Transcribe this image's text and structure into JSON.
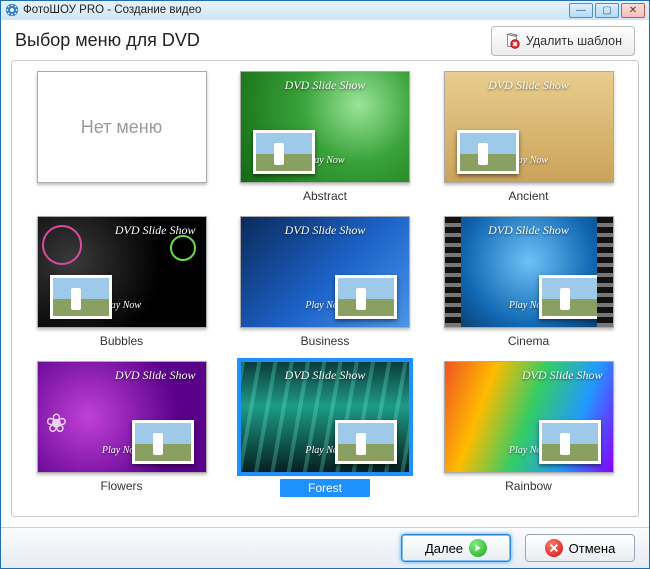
{
  "titlebar": {
    "title": "ФотоШОУ PRO - Создание видео"
  },
  "header": {
    "heading": "Выбор меню для DVD",
    "delete_template": "Удалить шаблон"
  },
  "template_strings": {
    "slide_title": "DVD Slide Show",
    "play_now": "Play Now"
  },
  "templates": [
    {
      "id": "none",
      "label": "Нет меню",
      "bg": "bg-none",
      "selected": false,
      "blank": true
    },
    {
      "id": "abstract",
      "label": "Abstract",
      "bg": "bg-abstract",
      "selected": false,
      "photo_pos": "left"
    },
    {
      "id": "ancient",
      "label": "Ancient",
      "bg": "bg-ancient",
      "selected": false,
      "photo_pos": "left"
    },
    {
      "id": "bubbles",
      "label": "Bubbles",
      "bg": "bg-bubbles",
      "selected": false,
      "photo_pos": "left",
      "title_align": "right"
    },
    {
      "id": "business",
      "label": "Business",
      "bg": "bg-business",
      "selected": false,
      "photo_pos": "right"
    },
    {
      "id": "cinema",
      "label": "Cinema",
      "bg": "bg-cinema",
      "selected": false,
      "photo_pos": "right"
    },
    {
      "id": "flowers",
      "label": "Flowers",
      "bg": "bg-flowers",
      "selected": false,
      "photo_pos": "right",
      "title_align": "right"
    },
    {
      "id": "forest",
      "label": "Forest",
      "bg": "bg-forest",
      "selected": true,
      "photo_pos": "right"
    },
    {
      "id": "rainbow",
      "label": "Rainbow",
      "bg": "bg-rainbow",
      "selected": false,
      "photo_pos": "right",
      "title_align": "right"
    }
  ],
  "footer": {
    "next": "Далее",
    "cancel": "Отмена"
  }
}
